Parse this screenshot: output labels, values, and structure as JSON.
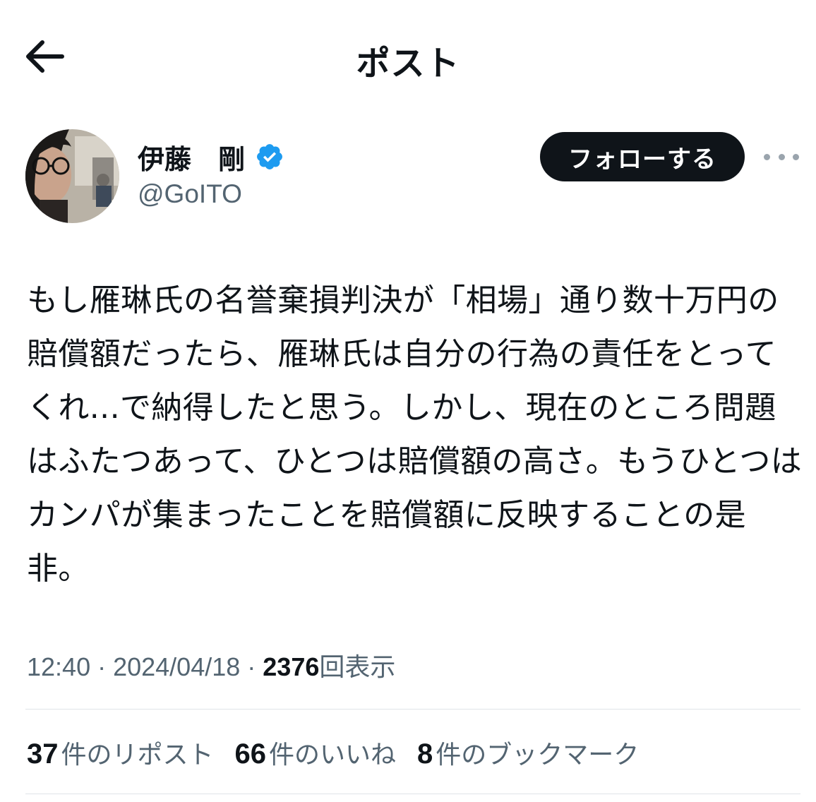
{
  "header": {
    "title": "ポスト",
    "back_icon": "arrow-left-icon"
  },
  "author": {
    "name": "伊藤　剛",
    "handle": "@GoITO",
    "verified": true,
    "verified_color": "#1d9bf0"
  },
  "actions": {
    "follow_label": "フォローする",
    "more_icon": "more-horizontal-icon"
  },
  "post": {
    "text": "もし雁琳氏の名誉棄損判決が「相場」通り数十万円の賠償額だったら、雁琳氏は自分の行為の責任をとってくれ...で納得したと思う。しかし、現在のところ問題はふたつあって、ひとつは賠償額の高さ。もうひとつはカンパが集まったことを賠償額に反映することの是非。"
  },
  "meta": {
    "time": "12:40",
    "separator": "·",
    "date": "2024/04/18",
    "views_count": "2376",
    "views_label": "回表示"
  },
  "stats": {
    "reposts_count": "37",
    "reposts_label": "件のリポスト",
    "likes_count": "66",
    "likes_label": "件のいいね",
    "bookmarks_count": "8",
    "bookmarks_label": "件のブックマーク"
  },
  "colors": {
    "text_primary": "#0f1419",
    "text_secondary": "#536471",
    "follow_button_bg": "#0f1419",
    "divider": "#dfe4e8"
  }
}
